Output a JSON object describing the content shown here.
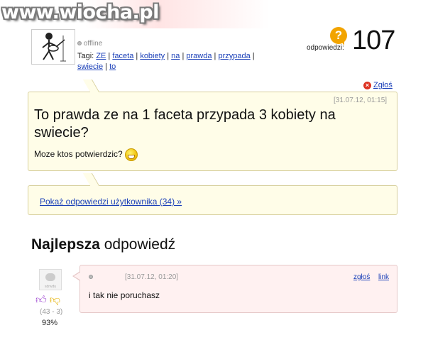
{
  "watermark": "www.wiocha.pl",
  "user": {
    "status": "offline"
  },
  "tags": {
    "label": "Tagi:",
    "items": [
      "ZE",
      "faceta",
      "kobiety",
      "na",
      "prawda",
      "przypada",
      "swiecie",
      "to"
    ]
  },
  "answers": {
    "icon_char": "?",
    "label": "odpowiedzi:",
    "count": "107"
  },
  "report": {
    "label": "Zgłoś"
  },
  "question": {
    "date": "[31.07.12, 01:15]",
    "title": "To prawda ze na 1 faceta przypada 3 kobiety na swiecie?",
    "body": "Moze ktos potwierdzic?"
  },
  "show_answers_link": "Pokaż odpowiedzi użytkownika (34) »",
  "best_answer": {
    "heading_bold": "Najlepsza",
    "heading_rest": " odpowiedź",
    "avatar_text": "sdnvdu",
    "score": "(43 - 3)",
    "percent": "93%",
    "date": "[31.07.12, 01:20]",
    "report_label": "zgłoś",
    "link_label": "link",
    "text": "i tak nie poruchasz"
  },
  "colors": {
    "link": "#1a3fb8",
    "question_bg": "#fffde8",
    "answer_bg": "#fff1f1",
    "badge": "#f2a400"
  }
}
